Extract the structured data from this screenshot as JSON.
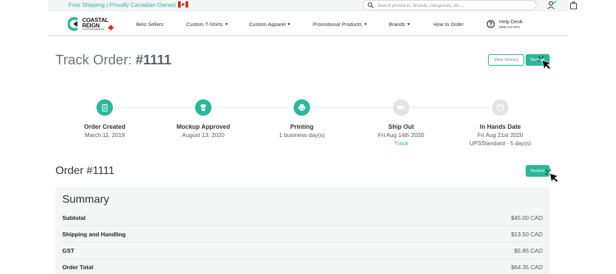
{
  "topbar": {
    "shipping_text": "Free Shipping | Proudly Canadian Owned",
    "search_placeholder": "Search products, brands, categories, etc...."
  },
  "logo": {
    "line1": "COASTAL",
    "line2": "REIGN",
    "sub": "CUSTOM MERCH"
  },
  "nav": {
    "items": [
      {
        "label": "Best Sellers",
        "dropdown": false
      },
      {
        "label": "Custom T-Shirts",
        "dropdown": true
      },
      {
        "label": "Custom Apparel",
        "dropdown": true
      },
      {
        "label": "Promotional Products",
        "dropdown": true
      },
      {
        "label": "Brands",
        "dropdown": true
      },
      {
        "label": "How to Order",
        "dropdown": false
      }
    ],
    "help_label": "Help Desk",
    "help_phone": "(888)-210-3971"
  },
  "header": {
    "title_prefix": "Track Order:",
    "title_number": "#1111",
    "view_history_label": "View History",
    "invoice_label": "Invoice"
  },
  "timeline": {
    "steps": [
      {
        "title": "Order Created",
        "subtitle": "March 11, 2019",
        "status": "done",
        "icon": "clipboard-icon"
      },
      {
        "title": "Mockup Approved",
        "subtitle": "August 13, 2020",
        "status": "done",
        "icon": "shirt-icon"
      },
      {
        "title": "Printing",
        "subtitle": "1 business day(s)",
        "status": "done",
        "icon": "printer-icon"
      },
      {
        "title": "Ship Out",
        "subtitle": "Fri Aug 14th 2020",
        "link": "Track",
        "status": "pending",
        "icon": "truck-icon"
      },
      {
        "title": "In Hands Date",
        "subtitle": "Fri Aug 21st 2020",
        "subtitle2": "UPSStandard - 5 day(s)",
        "status": "pending",
        "icon": "calendar-icon"
      }
    ]
  },
  "order": {
    "title": "Order #1111",
    "invoice_label": "Invoice"
  },
  "summary": {
    "title": "Summary",
    "rows": [
      {
        "label": "Subtotal",
        "value": "$45.00 CAD"
      },
      {
        "label": "Shipping and Handling",
        "value": "$13.50 CAD"
      },
      {
        "label": "GST",
        "value": "$5.85 CAD"
      },
      {
        "label": "Order Total",
        "value": "$64.35 CAD"
      }
    ]
  },
  "colors": {
    "accent": "#2bb89a",
    "pending": "#e3e3e3",
    "title_gray": "#6b7380"
  }
}
